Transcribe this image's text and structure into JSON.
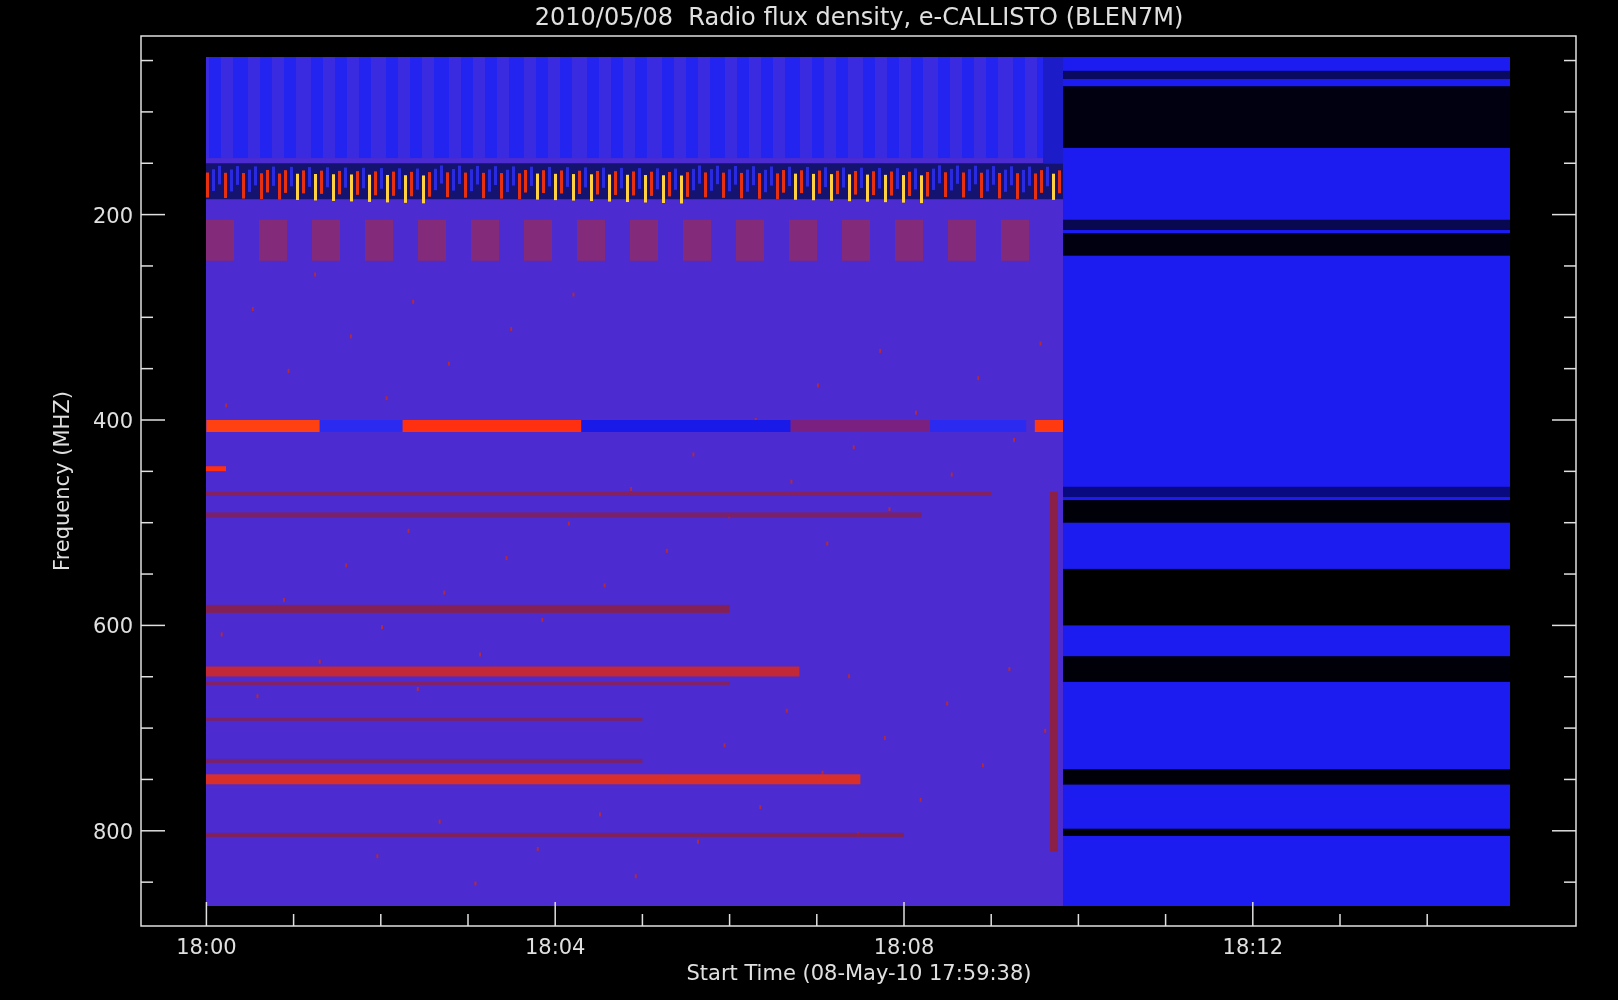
{
  "title": "2010/05/08  Radio flux density, e-CALLISTO (BLEN7M)",
  "y_axis": {
    "label": "Frequency (MHZ)",
    "ticks": [
      "200",
      "400",
      "600",
      "800"
    ]
  },
  "x_axis": {
    "label": "Start Time (08-May-10 17:59:38)",
    "ticks": [
      "18:00",
      "18:04",
      "18:08",
      "18:12"
    ]
  }
}
